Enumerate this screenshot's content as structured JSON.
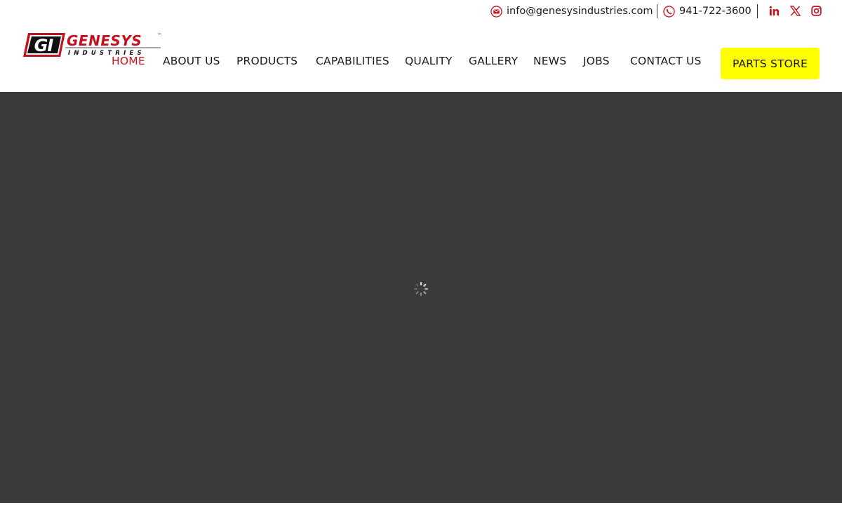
{
  "topbar": {
    "email": "info@genesysindustries.com",
    "phone": "941-722-3600",
    "email_icon": "envelope-icon",
    "phone_icon": "phone-icon",
    "social": [
      "linkedin-icon",
      "x-icon",
      "instagram-icon"
    ]
  },
  "brand": {
    "initials": "GI",
    "name": "GENESYS",
    "tagline": "INDUSTRIES",
    "trademark": "™",
    "primary_color": "#c1121f"
  },
  "nav": {
    "items": [
      {
        "label": "HOME",
        "active": true
      },
      {
        "label": "ABOUT US"
      },
      {
        "label": "PRODUCTS"
      },
      {
        "label": "CAPABILITIES"
      },
      {
        "label": "QUALITY"
      },
      {
        "label": "GALLERY"
      },
      {
        "label": "NEWS"
      },
      {
        "label": "JOBS"
      },
      {
        "label": "CONTACT US"
      }
    ],
    "cta": "PARTS STORE",
    "cta_color": "#ffff00"
  },
  "hero": {
    "background": "#3a3a3a",
    "loader_icon": "loading-spinner-icon"
  }
}
